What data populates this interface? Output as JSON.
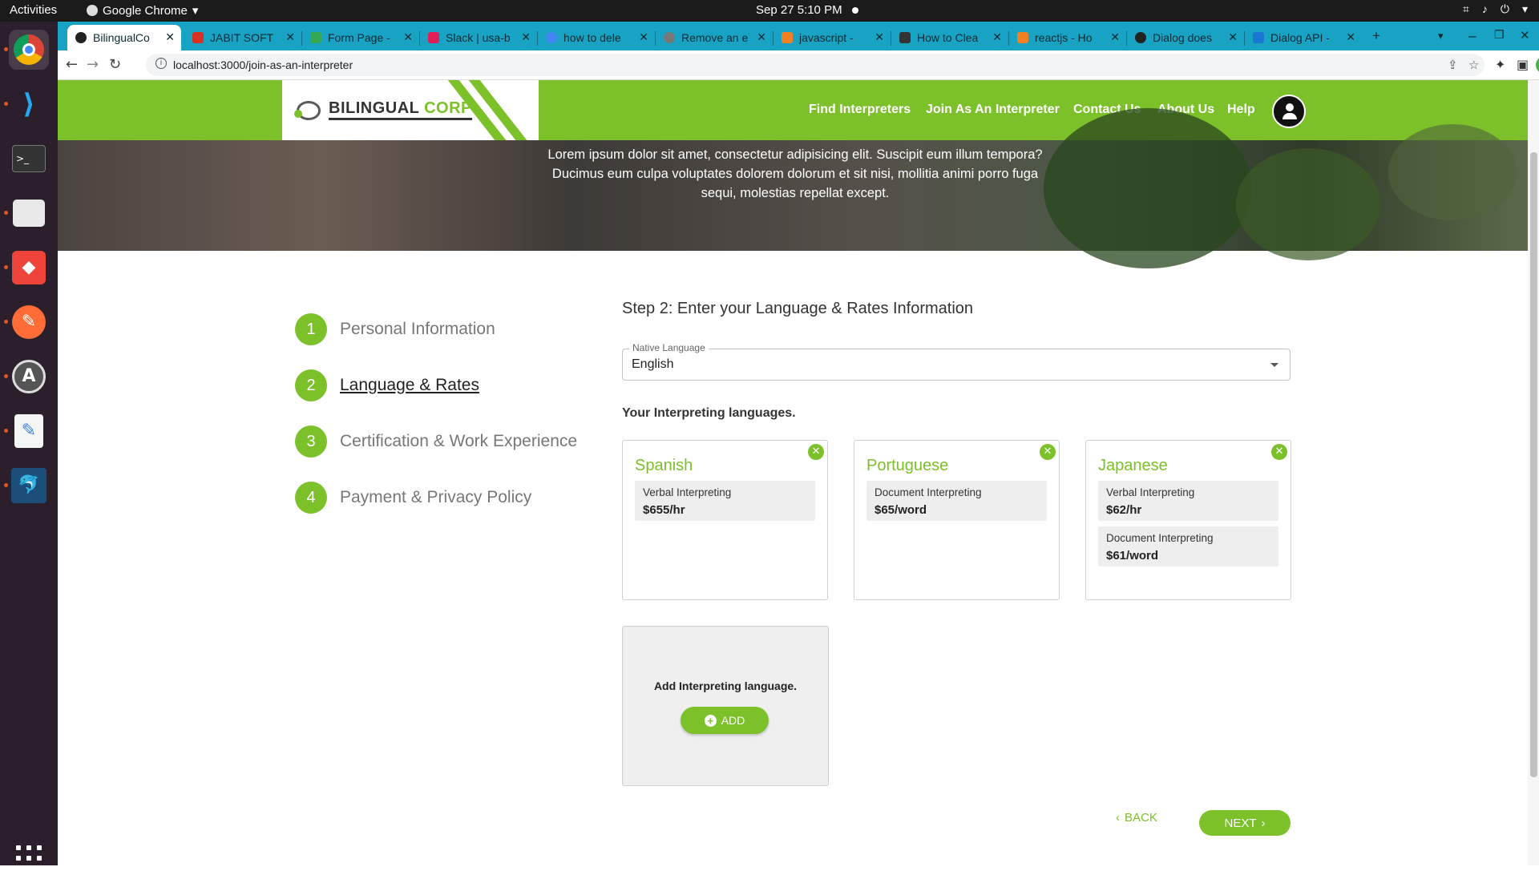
{
  "os": {
    "activities": "Activities",
    "app_name": "Google Chrome",
    "clock": "Sep 27   5:10 PM"
  },
  "browser": {
    "tabs": [
      {
        "title": "BilingualCo",
        "color": "#222222"
      },
      {
        "title": "JABIT SOFT",
        "color": "#d93025"
      },
      {
        "title": "Form Page -",
        "color": "#34a853"
      },
      {
        "title": "Slack | usa-b",
        "color": "#e01e5a"
      },
      {
        "title": "how to dele",
        "color": "#4285f4"
      },
      {
        "title": "Remove an e",
        "color": "#777777"
      },
      {
        "title": "javascript - ",
        "color": "#f48024"
      },
      {
        "title": "How to Clea",
        "color": "#333333"
      },
      {
        "title": "reactjs - Ho",
        "color": "#f48024"
      },
      {
        "title": "Dialog does",
        "color": "#222222"
      },
      {
        "title": "Dialog API -",
        "color": "#1976d2"
      }
    ],
    "url": "localhost:3000/join-as-an-interpreter",
    "profile_initial": "A"
  },
  "site": {
    "logo_main": "BILINGUAL ",
    "logo_accent": "CORP",
    "nav": [
      "Find Interpreters",
      "Join As An Interpreter",
      "Contact Us",
      "About Us",
      "Help"
    ],
    "hero_text": "Lorem ipsum dolor sit amet, consectetur adipisicing elit. Suscipit eum illum tempora? Ducimus eum culpa voluptates dolorem dolorum et sit nisi, mollitia animi porro fuga sequi, molestias repellat except."
  },
  "stepper": {
    "steps": [
      {
        "num": "1",
        "label": "Personal Information"
      },
      {
        "num": "2",
        "label": "Language & Rates"
      },
      {
        "num": "3",
        "label": "Certification & Work Experience"
      },
      {
        "num": "4",
        "label": "Payment & Privacy Policy"
      }
    ],
    "current": 2
  },
  "form": {
    "step_title": "Step 2: Enter your Language & Rates Information",
    "native_language_label": "Native Language",
    "native_language_value": "English",
    "interpreting_heading": "Your Interpreting languages.",
    "languages": [
      {
        "name": "Spanish",
        "services": [
          {
            "type": "Verbal Interpreting",
            "rate": "$655/hr"
          }
        ]
      },
      {
        "name": "Portuguese",
        "services": [
          {
            "type": "Document Interpreting",
            "rate": "$65/word"
          }
        ]
      },
      {
        "name": "Japanese",
        "services": [
          {
            "type": "Verbal Interpreting",
            "rate": "$62/hr"
          },
          {
            "type": "Document Interpreting",
            "rate": "$61/word"
          }
        ]
      }
    ],
    "add_text": "Add Interpreting language.",
    "add_button": "ADD",
    "back_button": "BACK",
    "next_button": "NEXT"
  },
  "colors": {
    "brand_green": "#7cc12a",
    "chrome_tabstrip": "#18a3c4"
  }
}
